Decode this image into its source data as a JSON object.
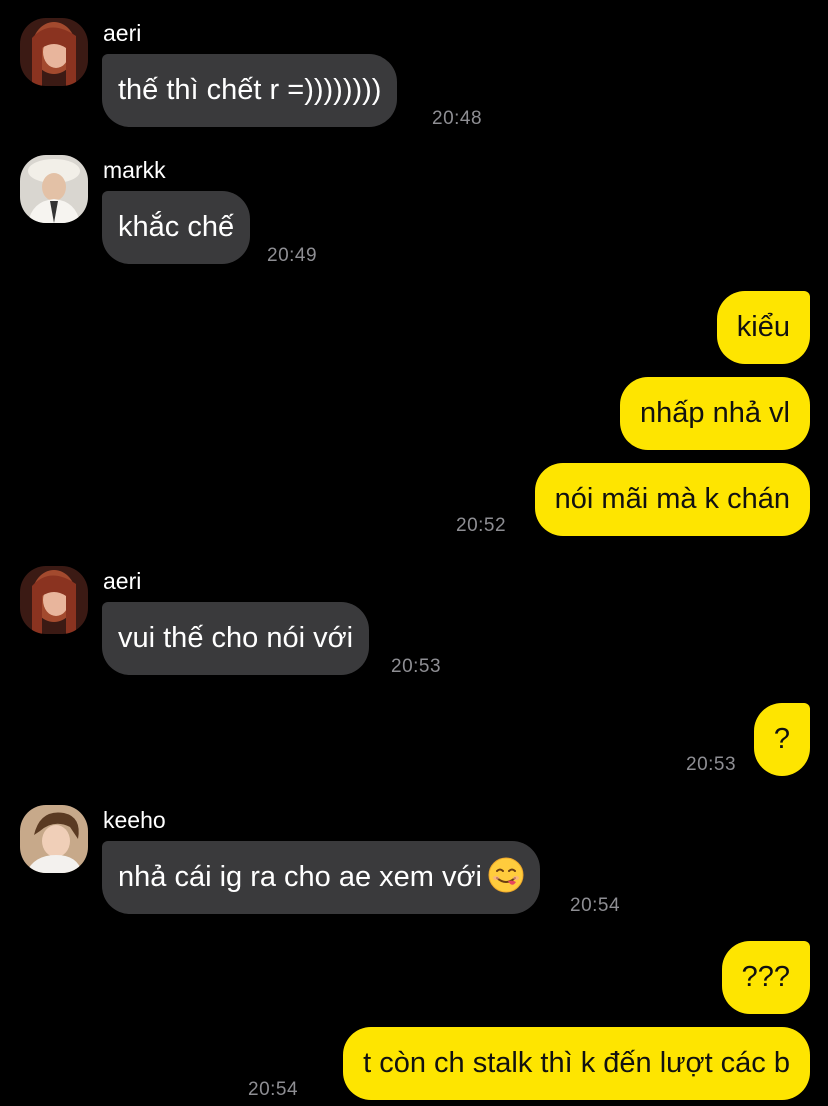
{
  "colors": {
    "background": "#000000",
    "incoming_bubble": "#3a3a3c",
    "outgoing_bubble": "#fee500",
    "timestamp": "#8e8e93"
  },
  "messages": [
    {
      "sender": "aeri",
      "avatar": "avatar-aeri",
      "text": "thế thì chết r =))))))))",
      "time": "20:48"
    },
    {
      "sender": "markk",
      "avatar": "avatar-markk",
      "text": "khắc chế",
      "time": "20:49"
    },
    {
      "outgoing": true,
      "text": "kiểu"
    },
    {
      "outgoing": true,
      "text": "nhấp nhả vl"
    },
    {
      "outgoing": true,
      "text": "nói mãi mà k chán",
      "time": "20:52"
    },
    {
      "sender": "aeri",
      "avatar": "avatar-aeri",
      "text": "vui thế cho nói với",
      "time": "20:53"
    },
    {
      "outgoing": true,
      "text": "?",
      "time": "20:53"
    },
    {
      "sender": "keeho",
      "avatar": "avatar-keeho",
      "text": "nhả cái ig ra cho ae xem với",
      "emoji": "savoring-face-emoji",
      "time": "20:54"
    },
    {
      "outgoing": true,
      "text": "???"
    },
    {
      "outgoing": true,
      "text": "t còn ch stalk thì k đến lượt các b",
      "time": "20:54"
    }
  ]
}
